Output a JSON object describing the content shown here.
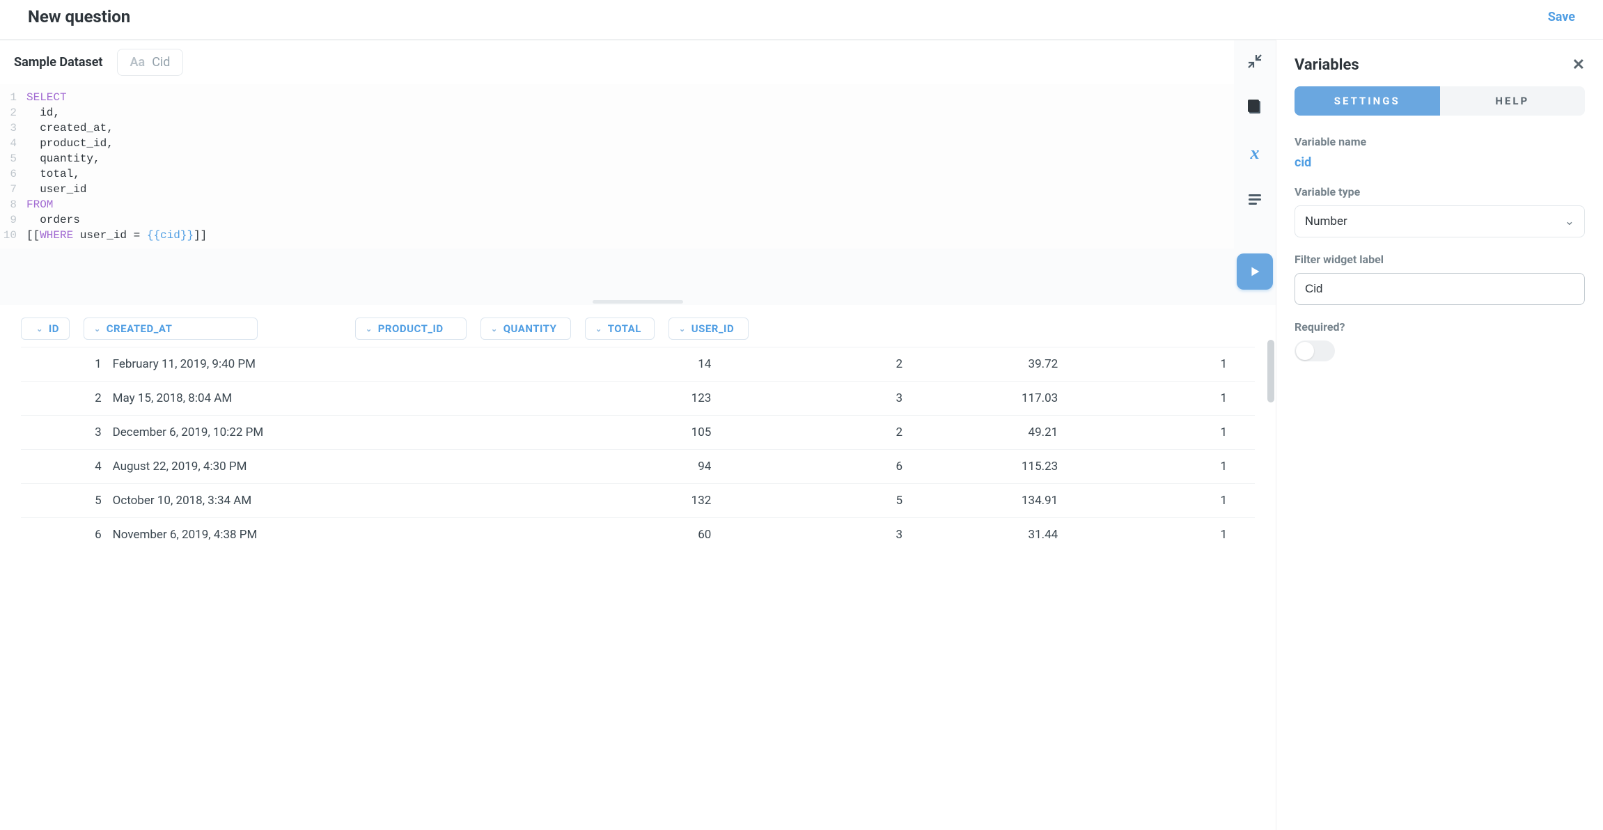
{
  "header": {
    "title": "New question",
    "save_label": "Save"
  },
  "editor": {
    "dataset_name": "Sample Dataset",
    "filter_placeholder": "Cid",
    "line_count": 10,
    "code_lines": [
      {
        "t": "kw",
        "v": "SELECT"
      },
      {
        "t": "plain",
        "v": "  id,"
      },
      {
        "t": "plain",
        "v": "  created_at,"
      },
      {
        "t": "plain",
        "v": "  product_id,"
      },
      {
        "t": "plain",
        "v": "  quantity,"
      },
      {
        "t": "plain",
        "v": "  total,"
      },
      {
        "t": "plain",
        "v": "  user_id"
      },
      {
        "t": "kw",
        "v": "FROM"
      },
      {
        "t": "plain",
        "v": "  orders"
      },
      {
        "t": "where",
        "pre": "[[",
        "kw": "WHERE",
        "mid": " user_id = ",
        "tmpl": "{{cid}}",
        "post": "]]"
      }
    ]
  },
  "results": {
    "columns": [
      "ID",
      "CREATED_AT",
      "PRODUCT_ID",
      "QUANTITY",
      "TOTAL",
      "USER_ID"
    ],
    "rows": [
      {
        "id": 1,
        "created_at": "February 11, 2019, 9:40 PM",
        "product_id": 14,
        "quantity": 2,
        "total": "39.72",
        "user_id": 1
      },
      {
        "id": 2,
        "created_at": "May 15, 2018, 8:04 AM",
        "product_id": 123,
        "quantity": 3,
        "total": "117.03",
        "user_id": 1
      },
      {
        "id": 3,
        "created_at": "December 6, 2019, 10:22 PM",
        "product_id": 105,
        "quantity": 2,
        "total": "49.21",
        "user_id": 1
      },
      {
        "id": 4,
        "created_at": "August 22, 2019, 4:30 PM",
        "product_id": 94,
        "quantity": 6,
        "total": "115.23",
        "user_id": 1
      },
      {
        "id": 5,
        "created_at": "October 10, 2018, 3:34 AM",
        "product_id": 132,
        "quantity": 5,
        "total": "134.91",
        "user_id": 1
      },
      {
        "id": 6,
        "created_at": "November 6, 2019, 4:38 PM",
        "product_id": 60,
        "quantity": 3,
        "total": "31.44",
        "user_id": 1
      }
    ]
  },
  "panel": {
    "title": "Variables",
    "tabs": {
      "settings": "SETTINGS",
      "help": "HELP"
    },
    "var_name_label": "Variable name",
    "var_name": "cid",
    "var_type_label": "Variable type",
    "var_type_value": "Number",
    "filter_widget_label": "Filter widget label",
    "filter_widget_value": "Cid",
    "required_label": "Required?",
    "required_value": false
  }
}
